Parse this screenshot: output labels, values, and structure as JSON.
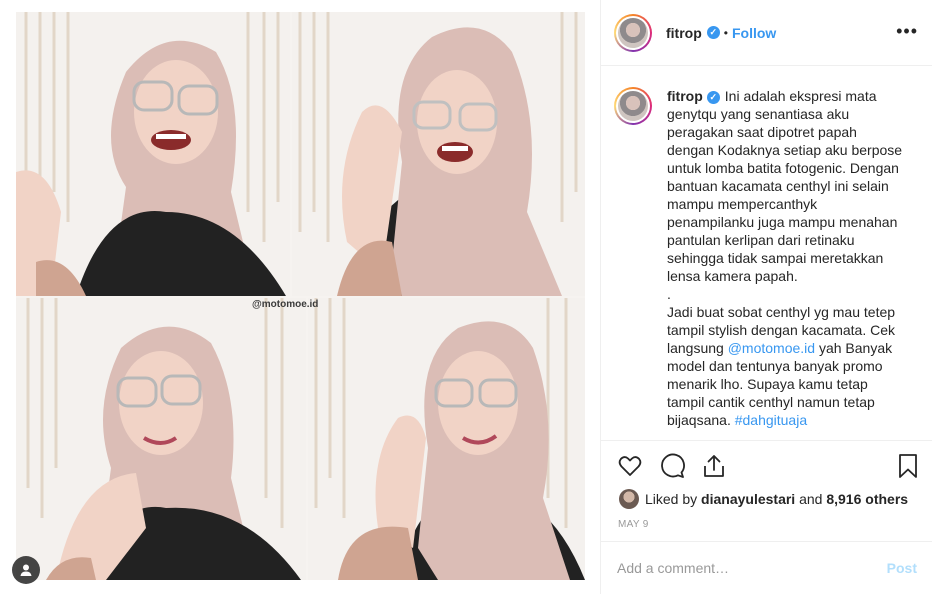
{
  "post": {
    "username": "fitrop",
    "verified_mark": "✓",
    "separator": "•",
    "follow_label": "Follow",
    "more_label": "•••",
    "watermark": "@motomoe.id",
    "caption_text_1": "Ini adalah ekspresi mata genytqu yang senantiasa aku peragakan saat dipotret papah dengan Kodaknya setiap aku berpose untuk lomba batita fotogenic. Dengan bantuan kacamata centhyl ini selain mampu mempercanthyk penampilanku juga mampu menahan pantulan kerlipan dari retinaku sehingga tidak sampai meretakkan lensa kamera papah.\n.\nJadi buat sobat centhyl yg mau tetep tampil stylish dengan kacamata. Cek langsung ",
    "caption_link_1": "@motomoe.id",
    "caption_text_2": " yah Banyak model dan tentunya banyak promo menarik lho. Supaya kamu tetap tampil cantik centhyl namun tetap bijaqsana. ",
    "caption_link_2": "#dahgituaja",
    "liked_by_prefix": "Liked by ",
    "liked_by_user": "dianayulestari",
    "liked_by_mid": " and ",
    "liked_by_count": "8,916 others",
    "date": "MAY 9",
    "comment_placeholder": "Add a comment…",
    "post_label": "Post"
  },
  "colors": {
    "accent": "#3897f0",
    "text": "#262626",
    "muted": "#999999",
    "post_disabled": "#b2dffc"
  },
  "icons": [
    "heart-icon",
    "comment-icon",
    "share-icon",
    "bookmark-icon",
    "user-tag-icon",
    "verified-icon"
  ]
}
